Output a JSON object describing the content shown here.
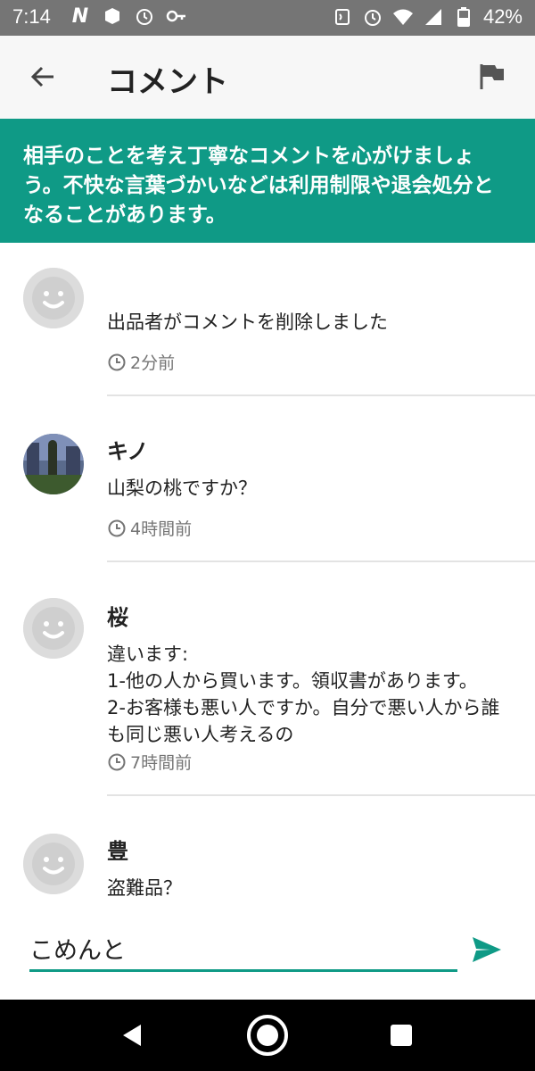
{
  "status_bar": {
    "time": "7:14",
    "left_icons": [
      "n-icon",
      "notification-icon",
      "alarm-icon",
      "key-icon"
    ],
    "right_icons": [
      "nfc-icon",
      "alarm-icon",
      "wifi-icon",
      "signal-icon",
      "battery-icon"
    ],
    "battery": "42%"
  },
  "app_bar": {
    "title": "コメント",
    "back_icon": "arrow-back-icon",
    "flag_icon": "flag-icon"
  },
  "notice": {
    "text": "相手のことを考え丁寧なコメントを心がけましょう。不快な言葉づかいなどは利用制限や退会処分となることがあります。"
  },
  "comments": [
    {
      "name": "",
      "text": "出品者がコメントを削除しました",
      "time": "2分前",
      "avatar": "default-avatar"
    },
    {
      "name": "キノ",
      "text": "山梨の桃ですか？",
      "time": "4時間前",
      "avatar": "photo-avatar"
    },
    {
      "name": "桜",
      "text": "違います:\n1-他の人から買います。領収書があります。\n2-お客様も悪い人ですか。自分で悪い人から誰も同じ悪い人考えるの",
      "time": "7時間前",
      "avatar": "default-avatar"
    },
    {
      "name": "豊",
      "text": "盗難品？",
      "time": "",
      "avatar": "default-avatar"
    }
  ],
  "input": {
    "value": "こめんと",
    "send_icon": "send-icon"
  },
  "colors": {
    "accent": "#0f9a86",
    "status_bar": "#757575",
    "app_bar": "#f7f7f7",
    "nav_bar": "#000000"
  }
}
